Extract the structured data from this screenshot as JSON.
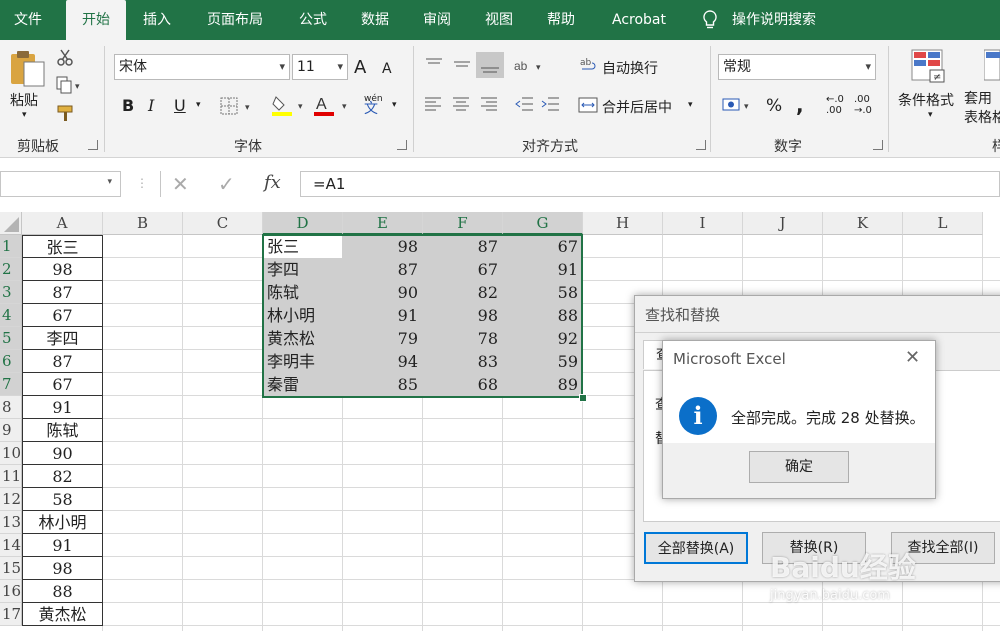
{
  "ribbon_tabs": [
    "文件",
    "开始",
    "插入",
    "页面布局",
    "公式",
    "数据",
    "审阅",
    "视图",
    "帮助",
    "Acrobat"
  ],
  "tell_me": "操作说明搜索",
  "clipboard": {
    "paste": "粘贴",
    "label": "剪贴板"
  },
  "font": {
    "name": "宋体",
    "size": "11",
    "label": "字体",
    "bold": "B",
    "italic": "I",
    "underline": "U",
    "grow": "A",
    "shrink": "A",
    "font_color": "A",
    "phonetic_top": "wén",
    "phonetic_bottom": "文"
  },
  "alignment": {
    "wrap": "自动换行",
    "merge": "合并后居中",
    "label": "对齐方式"
  },
  "number": {
    "format": "常规",
    "percent": "%",
    "comma": ",",
    "inc_decimal": "←.0\n.00",
    "dec_decimal": ".00\n→.0",
    "label": "数字"
  },
  "styles": {
    "conditional": "条件格式",
    "table_format": "套用\n表格格式",
    "label": "样"
  },
  "formula_bar": {
    "cancel": "✕",
    "enter": "✓",
    "fx": "fx",
    "formula": "=A1"
  },
  "columns": [
    "A",
    "B",
    "C",
    "D",
    "E",
    "F",
    "G",
    "H",
    "I",
    "J",
    "K",
    "L"
  ],
  "rows": [
    "1",
    "2",
    "3",
    "4",
    "5",
    "6",
    "7",
    "8",
    "9",
    "10",
    "11",
    "12",
    "13",
    "14",
    "15",
    "16",
    "17"
  ],
  "column_a": [
    "张三",
    "98",
    "87",
    "67",
    "李四",
    "87",
    "67",
    "91",
    "陈轼",
    "90",
    "82",
    "58",
    "林小明",
    "91",
    "98",
    "88",
    "黄杰松"
  ],
  "table_d_g": [
    [
      "张三",
      "98",
      "87",
      "67"
    ],
    [
      "李四",
      "87",
      "67",
      "91"
    ],
    [
      "陈轼",
      "90",
      "82",
      "58"
    ],
    [
      "林小明",
      "91",
      "98",
      "88"
    ],
    [
      "黄杰松",
      "79",
      "78",
      "92"
    ],
    [
      "李明丰",
      "94",
      "83",
      "59"
    ],
    [
      "秦雷",
      "85",
      "68",
      "89"
    ]
  ],
  "find_replace": {
    "title": "查找和替换",
    "tab_find_partial": "查",
    "find_label_partial": "查",
    "replace_label_partial": "替",
    "replace_all": "全部替换(A)",
    "replace": "替换(R)",
    "find_all": "查找全部(I)"
  },
  "msgbox": {
    "title": "Microsoft Excel",
    "message": "全部完成。完成 28 处替换。",
    "ok": "确定",
    "icon": "i"
  },
  "watermark": {
    "logo": "Baidu经验",
    "url": "jingyan.baidu.com"
  },
  "colors": {
    "excel_green": "#217346",
    "selection_shade": "#cfcfcf",
    "info_blue": "#0b6fc9"
  }
}
